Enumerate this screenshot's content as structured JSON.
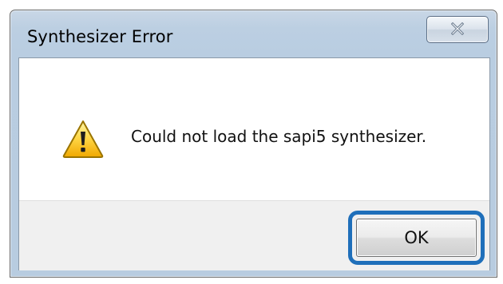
{
  "dialog": {
    "title": "Synthesizer Error",
    "close_icon": "close-icon",
    "message_icon": "warning-icon",
    "message": "Could not load the sapi5 synthesizer.",
    "ok_label": "OK",
    "highlight_color": "#1f6fba"
  }
}
